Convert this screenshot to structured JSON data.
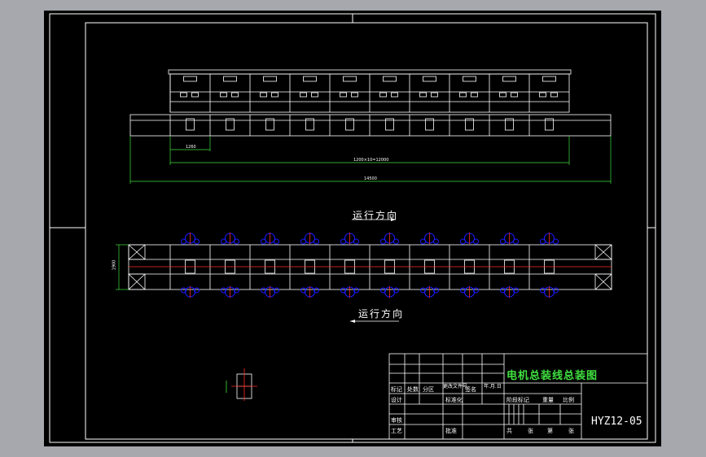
{
  "drawing": {
    "direction_label_top": "运行方向",
    "direction_label_bottom": "运行方向",
    "dimensions": {
      "segment": "1260",
      "total_inner": "1200×10=12000",
      "total_overall": "14500",
      "width": "1900"
    },
    "station_count": 10
  },
  "title_block": {
    "title": "电机总装线总装图",
    "drawing_number": "HYZ12-05",
    "row_labels": {
      "mark": "标记",
      "count": "处数",
      "zone": "分区",
      "change_doc": "更改文件号",
      "signature": "签名",
      "date": "年.月.日",
      "design": "设计",
      "standardize": "标准化",
      "review": "审核",
      "process": "工艺",
      "approve": "批准",
      "stage_mark": "阶段标记",
      "weight": "重量",
      "scale": "比例",
      "sheets_total": "共",
      "sheet": "张",
      "sheet_no": "第",
      "sheet2": "张"
    }
  },
  "colors": {
    "background": "#a6a8ad",
    "sheet": "#000000",
    "lines": "#ffffff",
    "dimension": "#3fe03f",
    "workstation": "#1a1aff",
    "centerline": "#ff2a2a"
  }
}
